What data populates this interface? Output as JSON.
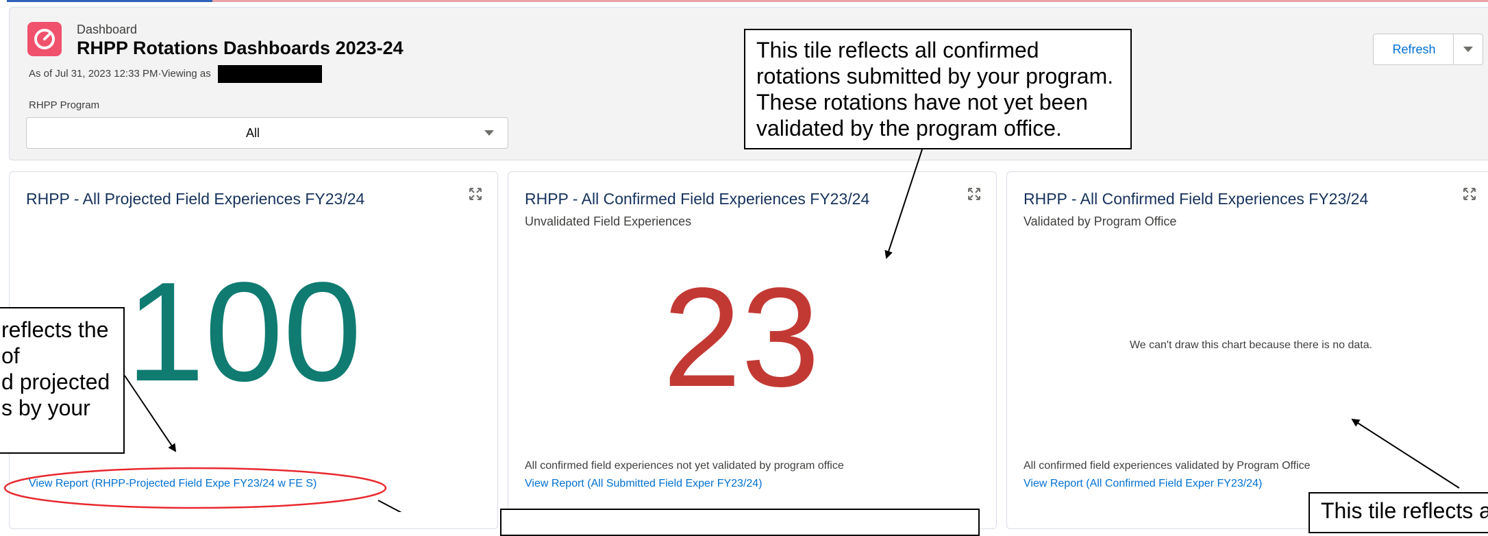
{
  "header": {
    "kicker": "Dashboard",
    "title": "RHPP Rotations Dashboards 2023-24",
    "as_of": "As of Jul 31, 2023 12:33 PM·Viewing as",
    "filter_label": "RHPP Program",
    "filter_value": "All",
    "refresh_label": "Refresh",
    "brand_color": "#f0516c"
  },
  "tiles": [
    {
      "title": "RHPP - All Projected Field Experiences FY23/24",
      "metric": "100",
      "metric_color": "#0f7b71",
      "report_link": "View Report (RHPP-Projected Field Expe FY23/24 w FE S)"
    },
    {
      "title": "RHPP - All Confirmed Field Experiences FY23/24",
      "subtitle": "Unvalidated Field Experiences",
      "metric": "23",
      "metric_color": "#c23934",
      "footer": "All confirmed field experiences not yet validated by program office",
      "report_link": "View Report (All Submitted Field Exper FY23/24)"
    },
    {
      "title": "RHPP - All Confirmed Field Experiences FY23/24",
      "subtitle": "Validated by Program Office",
      "no_data": "We can't draw this chart because there is no data.",
      "footer": "All confirmed field experiences validated by Program Office",
      "report_link": "View Report (All Confirmed Field Exper FY23/24)"
    }
  ],
  "callouts": {
    "confirmed": "This tile reflects all confirmed rotations submitted by your program. These rotations have not yet been validated by the program office.",
    "projected_lines": [
      "reflects the",
      "of",
      "d projected",
      "s by your"
    ],
    "validated_partial": "This tile reflects a"
  },
  "colors": {
    "link": "#0070d2",
    "highlight_oval": "#e8282e"
  }
}
